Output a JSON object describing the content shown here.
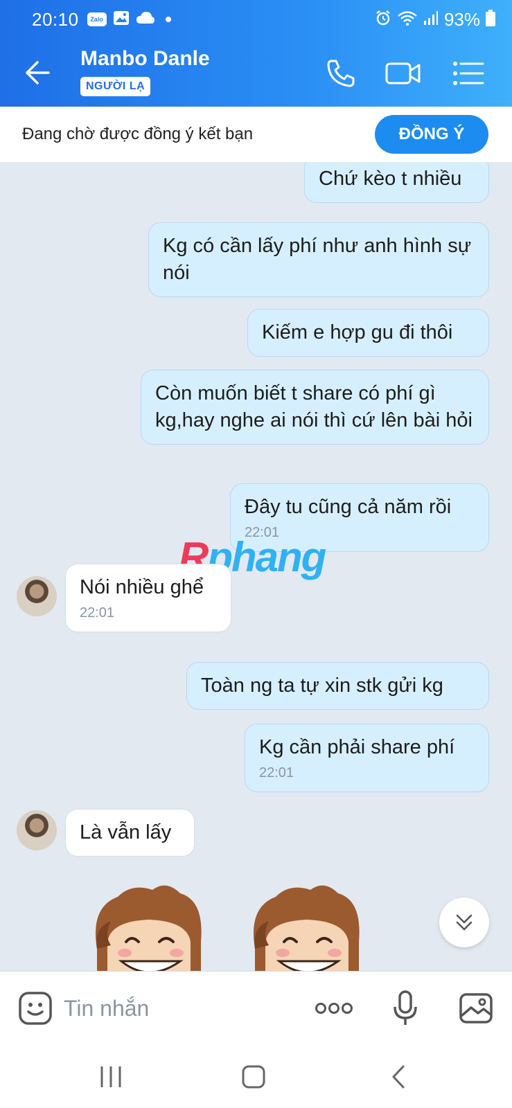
{
  "status_bar": {
    "time": "20:10",
    "zalo_label": "Zalo",
    "battery": "93%"
  },
  "header": {
    "contact_name": "Manbo Danle",
    "badge": "NGƯỜI LẠ"
  },
  "friend_request": {
    "text": "Đang chờ được đồng ý kết bạn",
    "accept_label": "ĐỒNG Ý"
  },
  "messages": [
    {
      "direction": "out",
      "text": "Chứ kèo t nhiều"
    },
    {
      "direction": "out",
      "text": "Kg có cần lấy phí như anh hình sự nói"
    },
    {
      "direction": "out",
      "text": "Kiếm e hợp gu đi thôi"
    },
    {
      "direction": "out",
      "text": "Còn muốn biết t share có phí gì kg,hay nghe ai nói thì cứ lên bài hỏi"
    },
    {
      "direction": "out",
      "text": "Đây tu cũng cả năm rồi",
      "time": "22:01"
    },
    {
      "direction": "in",
      "text": "Nói nhiều ghể",
      "time": "22:01"
    },
    {
      "direction": "out",
      "text": "Toàn ng ta tự xin stk gửi kg"
    },
    {
      "direction": "out",
      "text": "Kg cần phải share phí",
      "time": "22:01"
    },
    {
      "direction": "in",
      "text": "Là vẫn lấy"
    }
  ],
  "watermark": {
    "first": "R",
    "rest": "phang"
  },
  "input": {
    "placeholder": "Tin nhắn"
  },
  "icons": {
    "back": "arrow-left",
    "call": "phone",
    "video": "video-camera",
    "menu": "list",
    "emoji": "smiley",
    "more": "dots",
    "mic": "microphone",
    "image": "image",
    "scroll": "double-chevron-down"
  },
  "colors": {
    "header": "#2a8ff5",
    "accent": "#1d8cf0",
    "out_bubble": "#d6efff",
    "in_bubble": "#ffffff"
  }
}
